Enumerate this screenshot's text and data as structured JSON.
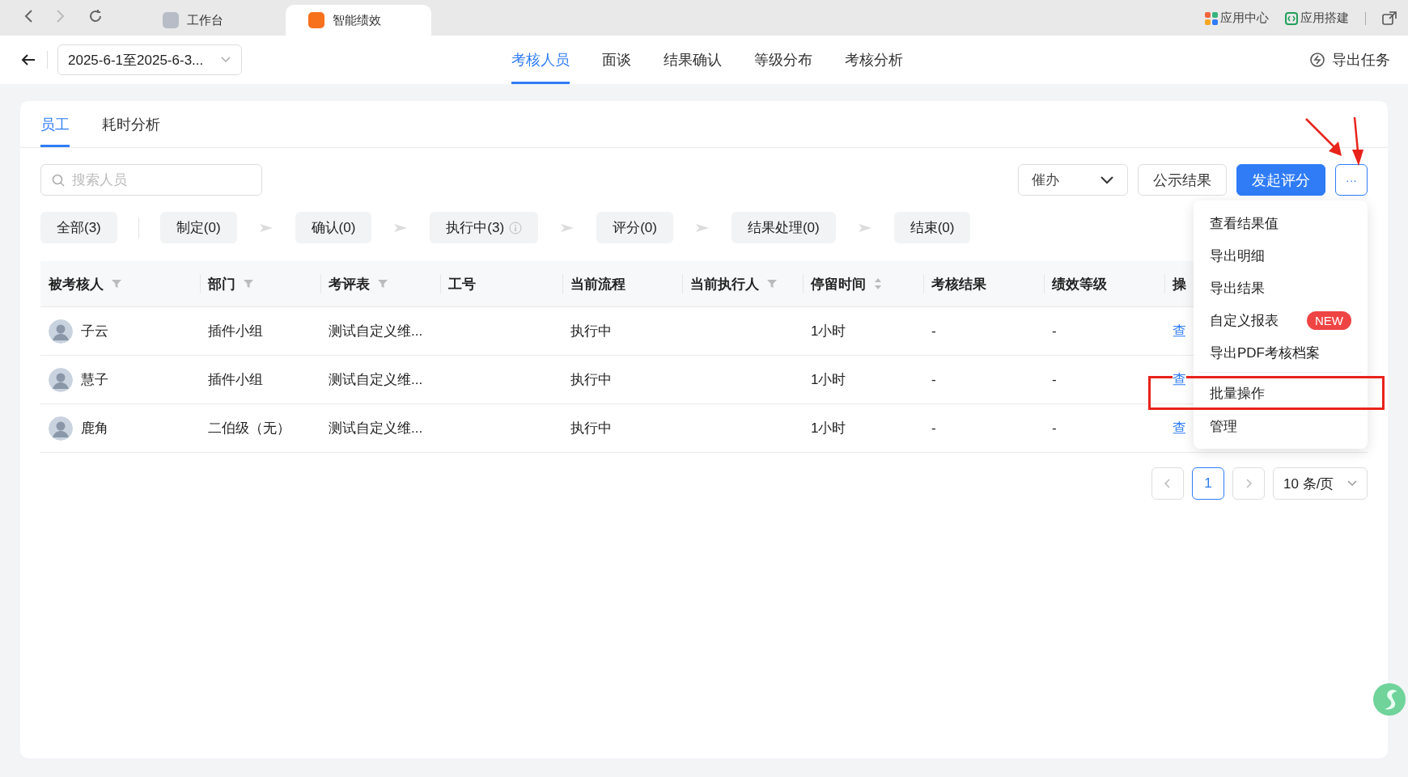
{
  "browser": {
    "tabs": [
      {
        "label": "工作台",
        "selected": false
      },
      {
        "label": "智能绩效",
        "selected": true
      }
    ],
    "links": [
      "应用中心",
      "应用搭建"
    ]
  },
  "header": {
    "date_range": "2025-6-1至2025-6-3...",
    "tabs": [
      {
        "label": "考核人员",
        "selected": true
      },
      {
        "label": "面谈",
        "selected": false
      },
      {
        "label": "结果确认",
        "selected": false
      },
      {
        "label": "等级分布",
        "selected": false
      },
      {
        "label": "考核分析",
        "selected": false
      }
    ],
    "export_tasks": "导出任务"
  },
  "subtabs": [
    {
      "label": "员工",
      "selected": true
    },
    {
      "label": "耗时分析",
      "selected": false
    }
  ],
  "search": {
    "placeholder": "搜索人员"
  },
  "actions": {
    "remind": "催办",
    "publish": "公示结果",
    "start": "发起评分",
    "more": "···"
  },
  "stages": [
    {
      "label": "全部(3)",
      "info": false
    },
    {
      "label": "制定(0)",
      "info": false
    },
    {
      "label": "确认(0)",
      "info": false
    },
    {
      "label": "执行中(3)",
      "info": true
    },
    {
      "label": "评分(0)",
      "info": false
    },
    {
      "label": "结果处理(0)",
      "info": false
    },
    {
      "label": "结束(0)",
      "info": false
    }
  ],
  "table": {
    "columns": [
      {
        "label": "被考核人",
        "kind": "filter"
      },
      {
        "label": "部门",
        "kind": "filter"
      },
      {
        "label": "考评表",
        "kind": "filter"
      },
      {
        "label": "工号",
        "kind": "plain"
      },
      {
        "label": "当前流程",
        "kind": "plain"
      },
      {
        "label": "当前执行人",
        "kind": "filter"
      },
      {
        "label": "停留时间",
        "kind": "sort"
      },
      {
        "label": "考核结果",
        "kind": "plain"
      },
      {
        "label": "绩效等级",
        "kind": "plain"
      },
      {
        "label": "操",
        "kind": "plain"
      }
    ],
    "rows": [
      {
        "name": "子云",
        "department": "插件小组",
        "form": "测试自定义维...",
        "process": "执行中",
        "stay": "1小时",
        "result": "-",
        "grade": "-",
        "action": "查"
      },
      {
        "name": "慧子",
        "department": "插件小组",
        "form": "测试自定义维...",
        "process": "执行中",
        "stay": "1小时",
        "result": "-",
        "grade": "-",
        "action": "查"
      },
      {
        "name": "鹿角",
        "department": "二伯级（无）",
        "form": "测试自定义维...",
        "process": "执行中",
        "stay": "1小时",
        "result": "-",
        "grade": "-",
        "action": "查"
      }
    ]
  },
  "menu": {
    "items": [
      {
        "kind": "item",
        "label": "查看结果值",
        "highlighted": false
      },
      {
        "kind": "item",
        "label": "导出明细",
        "highlighted": false
      },
      {
        "kind": "item",
        "label": "导出结果",
        "highlighted": false
      },
      {
        "kind": "item",
        "label": "自定义报表",
        "badge": "NEW",
        "highlighted": false
      },
      {
        "kind": "item",
        "label": "导出PDF考核档案",
        "highlighted": false
      },
      {
        "kind": "divider"
      },
      {
        "kind": "item",
        "label": "批量操作",
        "highlighted": true
      },
      {
        "kind": "item",
        "label": "管理",
        "highlighted": false
      }
    ]
  },
  "pagination": {
    "pages": [
      {
        "label": "1",
        "selected": true
      }
    ],
    "page_size": "10 条/页"
  }
}
